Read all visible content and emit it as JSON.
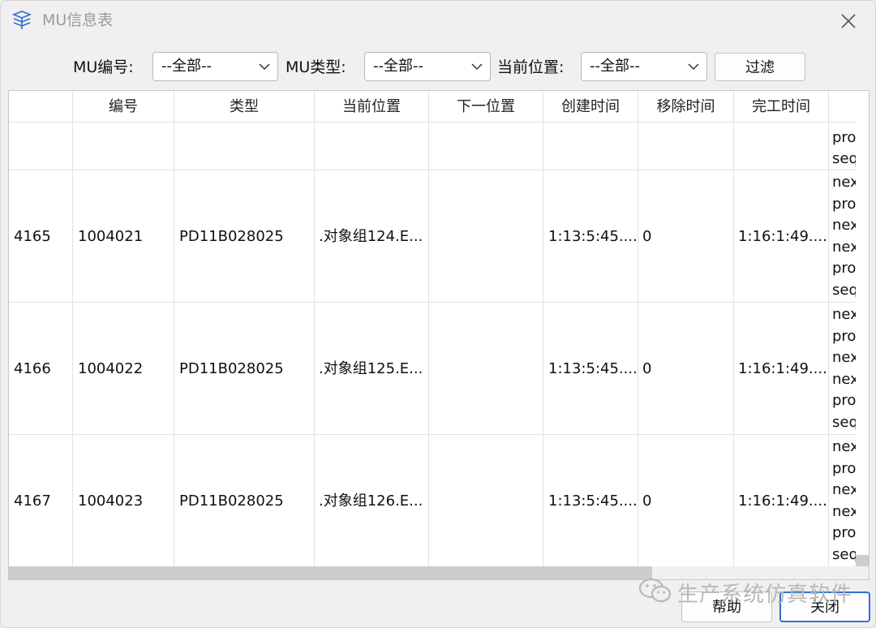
{
  "window": {
    "title": "MU信息表"
  },
  "filters": {
    "mu_id_label": "MU编号:",
    "mu_id_value": "--全部--",
    "mu_type_label": "MU类型:",
    "mu_type_value": "--全部--",
    "location_label": "当前位置:",
    "location_value": "--全部--",
    "filter_button": "过滤"
  },
  "table": {
    "columns": [
      "",
      "编号",
      "类型",
      "当前位置",
      "下一位置",
      "创建时间",
      "移除时间",
      "完工时间"
    ],
    "rows": [
      {
        "index": "",
        "id": "",
        "type": "",
        "location": "",
        "next": "",
        "created": "",
        "removed": "",
        "finished": "",
        "log": [
          "pro",
          "seq"
        ]
      },
      {
        "index": "4165",
        "id": "1004021",
        "type": "PD11B028025",
        "location": ".对象组124.E...",
        "next": "",
        "created": "1:13:5:45....",
        "removed": "0",
        "finished": "1:16:1:49....",
        "log": [
          "nex",
          "pro",
          "nex",
          "nex",
          "pro",
          "seq"
        ]
      },
      {
        "index": "4166",
        "id": "1004022",
        "type": "PD11B028025",
        "location": ".对象组125.E...",
        "next": "",
        "created": "1:13:5:45....",
        "removed": "0",
        "finished": "1:16:1:49....",
        "log": [
          "nex",
          "pro",
          "nex",
          "nex",
          "pro",
          "seq"
        ]
      },
      {
        "index": "4167",
        "id": "1004023",
        "type": "PD11B028025",
        "location": ".对象组126.E...",
        "next": "",
        "created": "1:13:5:45....",
        "removed": "0",
        "finished": "1:16:1:49....",
        "log": [
          "nex",
          "pro",
          "nex",
          "nex",
          "pro",
          "seq"
        ]
      }
    ]
  },
  "footer": {
    "help_button": "帮助",
    "close_button": "关闭",
    "watermark": "生产系统仿真软件"
  },
  "colors": {
    "accent": "#2f6fd6",
    "window_bg": "#f0f0f0",
    "grid_line": "#e2e2e2"
  },
  "icons": {
    "app": "layers-icon",
    "close": "close-icon",
    "dropdown": "chevron-down-icon",
    "watermark": "wechat-icon"
  }
}
